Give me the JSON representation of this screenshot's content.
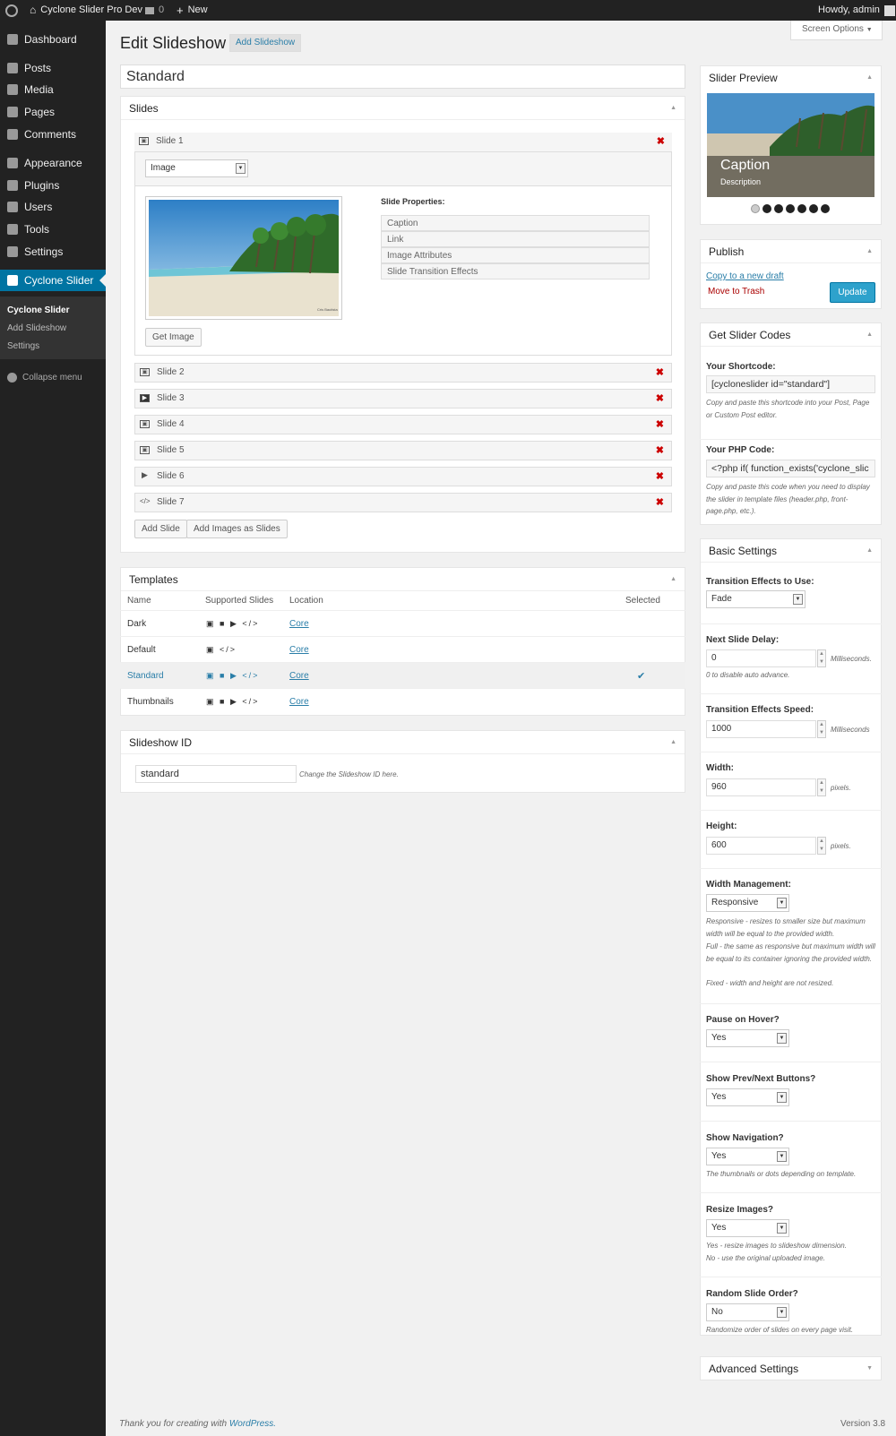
{
  "adminbar": {
    "site": "Cyclone Slider Pro Dev",
    "comments": "0",
    "new": "New",
    "howdy": "Howdy, admin"
  },
  "sidebar": {
    "items": [
      "Dashboard",
      "Posts",
      "Media",
      "Pages",
      "Comments",
      "Appearance",
      "Plugins",
      "Users",
      "Tools",
      "Settings",
      "Cyclone Slider"
    ],
    "submenu": [
      "Cyclone Slider",
      "Add Slideshow",
      "Settings"
    ],
    "collapse": "Collapse menu"
  },
  "page": {
    "title": "Edit Slideshow",
    "add_button": "Add Slideshow",
    "screen_options": "Screen Options",
    "slideshow_title": "Standard"
  },
  "slides": {
    "header": "Slides",
    "slide1_label": "Slide 1",
    "type": "Image",
    "props_title": "Slide Properties:",
    "props": [
      "Caption",
      "Link",
      "Image Attributes",
      "Slide Transition Effects"
    ],
    "get_image": "Get Image",
    "others": [
      {
        "label": "Slide 2",
        "icon": "image-icon"
      },
      {
        "label": "Slide 3",
        "icon": "video-icon"
      },
      {
        "label": "Slide 4",
        "icon": "image-icon"
      },
      {
        "label": "Slide 5",
        "icon": "image-icon"
      },
      {
        "label": "Slide 6",
        "icon": "play-icon"
      },
      {
        "label": "Slide 7",
        "icon": "code-icon"
      }
    ],
    "add_slide": "Add Slide",
    "add_images": "Add Images as Slides",
    "watermark": "Cris Bautista"
  },
  "templates": {
    "header": "Templates",
    "columns": [
      "Name",
      "Supported Slides",
      "Location",
      "Selected"
    ],
    "rows": [
      {
        "name": "Dark",
        "icons": "▣ ■ ▶ </>",
        "location": "Core",
        "selected": ""
      },
      {
        "name": "Default",
        "icons": "▣ </>",
        "location": "Core",
        "selected": ""
      },
      {
        "name": "Standard",
        "icons": "▣ ■ ▶ </>",
        "location": "Core",
        "selected": "✔"
      },
      {
        "name": "Thumbnails",
        "icons": "▣ ■ ▶ </>",
        "location": "Core",
        "selected": ""
      }
    ]
  },
  "slideshow_id": {
    "header": "Slideshow ID",
    "value": "standard",
    "hint": "Change the Slideshow ID here."
  },
  "preview": {
    "header": "Slider Preview",
    "caption": "Caption",
    "description": "Description"
  },
  "publish": {
    "header": "Publish",
    "copy_draft": "Copy to a new draft",
    "trash": "Move to Trash",
    "update": "Update"
  },
  "codes": {
    "header": "Get Slider Codes",
    "shortcode_label": "Your Shortcode:",
    "shortcode": "[cycloneslider id=\"standard\"]",
    "shortcode_hint": "Copy and paste this shortcode into your Post, Page or Custom Post editor.",
    "php_label": "Your PHP Code:",
    "php": "<?php if( function_exists('cyclone_slic",
    "php_hint": "Copy and paste this code when you need to display the slider in template files (header.php, front-page.php, etc.)."
  },
  "basic": {
    "header": "Basic Settings",
    "fx_label": "Transition Effects to Use:",
    "fx": "Fade",
    "delay_label": "Next Slide Delay:",
    "delay": "0",
    "delay_unit": "Milliseconds.",
    "delay_hint": "0 to disable auto advance.",
    "speed_label": "Transition Effects Speed:",
    "speed": "1000",
    "speed_unit": "Milliseconds",
    "width_label": "Width:",
    "width": "960",
    "width_unit": "pixels.",
    "height_label": "Height:",
    "height": "600",
    "height_unit": "pixels.",
    "wm_label": "Width Management:",
    "wm": "Responsive",
    "wm_hint1": "Responsive - resizes to smaller size but maximum width will be equal to the provided width.",
    "wm_hint2": "Full - the same as responsive but maximum width will be equal to its container ignoring the provided width.",
    "wm_hint3": "Fixed - width and height are not resized.",
    "hover_label": "Pause on Hover?",
    "hover": "Yes",
    "prevnext_label": "Show Prev/Next Buttons?",
    "prevnext": "Yes",
    "nav_label": "Show Navigation?",
    "nav": "Yes",
    "nav_hint": "The thumbnails or dots depending on template.",
    "resize_label": "Resize Images?",
    "resize": "Yes",
    "resize_hint1": "Yes - resize images to slideshow dimension.",
    "resize_hint2": "No - use the original uploaded image.",
    "random_label": "Random Slide Order?",
    "random": "No",
    "random_hint": "Randomize order of slides on every page visit."
  },
  "advanced": {
    "header": "Advanced Settings"
  },
  "footer": {
    "thanks": "Thank you for creating with ",
    "wp": "WordPress.",
    "version": "Version 3.8"
  }
}
